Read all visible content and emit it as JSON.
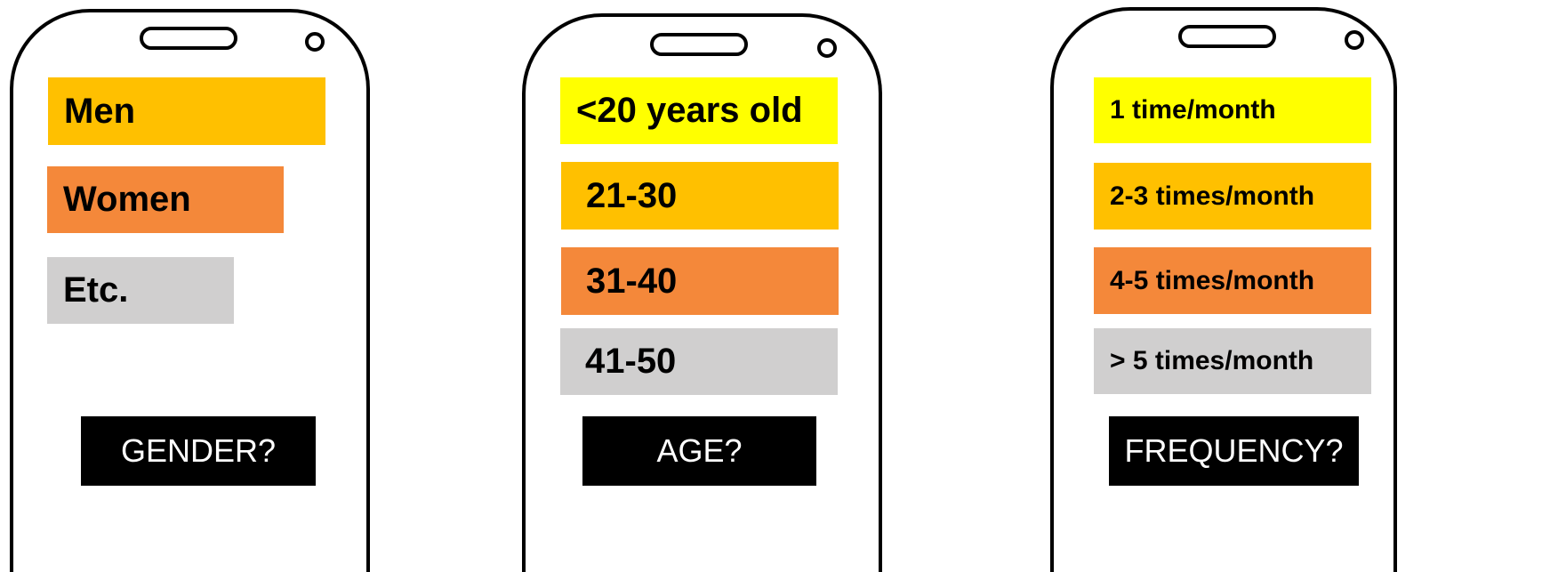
{
  "colors": {
    "yellow": "#ffff00",
    "amber": "#ffc000",
    "orange": "#f4883a",
    "gray": "#d0cfcf",
    "button_bg": "#000000",
    "button_text": "#ffffff"
  },
  "phones": [
    {
      "options": [
        "Men",
        "Women",
        "Etc."
      ],
      "button": "GENDER?"
    },
    {
      "options": [
        "<20 years old",
        "21-30",
        "31-40",
        "41-50"
      ],
      "button": "AGE?"
    },
    {
      "options": [
        "1 time/month",
        "2-3 times/month",
        "4-5 times/month",
        "> 5 times/month"
      ],
      "button": "FREQUENCY?"
    }
  ]
}
